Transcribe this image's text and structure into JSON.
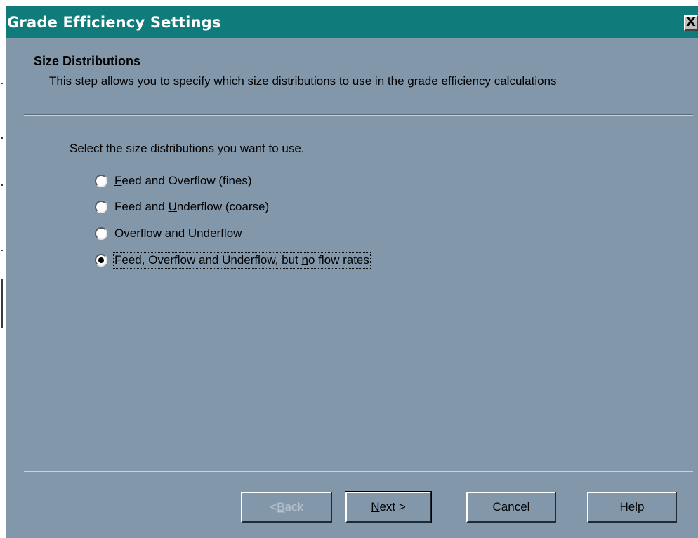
{
  "window": {
    "title": "Grade Efficiency Settings",
    "close_glyph": "X",
    "close_icon": "close-icon"
  },
  "header": {
    "title": "Size Distributions",
    "description": "This step allows you to specify which size distributions to use in the grade efficiency calculations"
  },
  "main": {
    "prompt": "Select the size distributions you want to use.",
    "options": [
      {
        "pre": "",
        "key": "F",
        "post": "eed and Overflow (fines)",
        "checked": false
      },
      {
        "pre": "Feed and ",
        "key": "U",
        "post": "nderflow (coarse)",
        "checked": false
      },
      {
        "pre": "",
        "key": "O",
        "post": "verflow and Underflow",
        "checked": false
      },
      {
        "pre": "Feed, Overflow and Underflow, but ",
        "key": "n",
        "post": "o flow rates",
        "checked": true
      }
    ]
  },
  "buttons": {
    "back": {
      "pre": "< ",
      "key": "B",
      "post": "ack",
      "enabled": false
    },
    "next": {
      "pre": "",
      "key": "N",
      "post": "ext >",
      "enabled": true
    },
    "cancel": {
      "label": "Cancel"
    },
    "help": {
      "label": "Help"
    }
  },
  "colors": {
    "titlebar": "#0f7b7b",
    "dialog_bg": "#8397ab",
    "title_text": "#ffffff"
  }
}
